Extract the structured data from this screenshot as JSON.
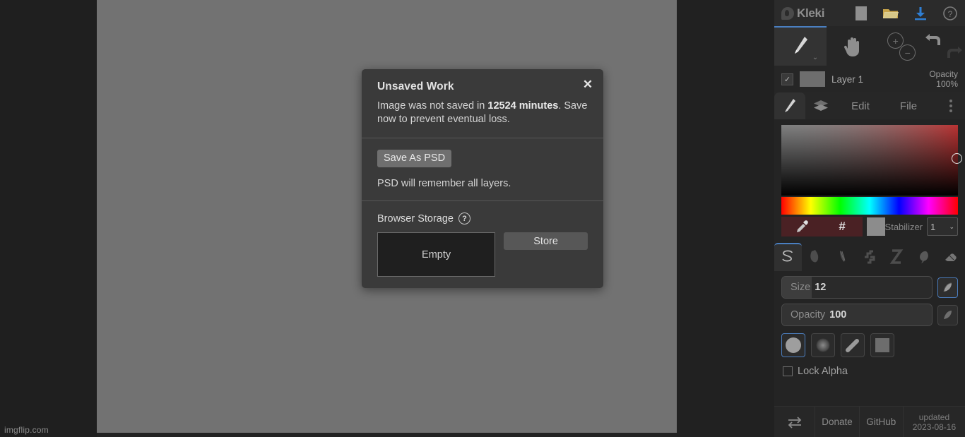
{
  "app": {
    "name": "Kleki",
    "watermark": "imgflip.com"
  },
  "topbar": {
    "icons": [
      {
        "name": "new-image-icon",
        "label": "New Image"
      },
      {
        "name": "open-folder-icon",
        "label": "Open"
      },
      {
        "name": "download-icon",
        "label": "Save / Download"
      },
      {
        "name": "help-icon",
        "label": "Help"
      }
    ]
  },
  "toolbar": {
    "brush_tool": "brush-tool",
    "hand_tool": "hand-tool",
    "zoom_in": "+",
    "zoom_out": "−",
    "undo": "undo-arrow",
    "redo": "redo-arrow"
  },
  "layer": {
    "visible": true,
    "name": "Layer 1",
    "opacity_label": "Opacity",
    "opacity_value": "100%"
  },
  "tabs": [
    {
      "name": "tab-brush",
      "label": "",
      "selected": true
    },
    {
      "name": "tab-layers",
      "label": "",
      "selected": false
    },
    {
      "name": "tab-edit",
      "label": "Edit",
      "selected": false
    },
    {
      "name": "tab-file",
      "label": "File",
      "selected": false
    },
    {
      "name": "tab-more",
      "label": "",
      "selected": false
    }
  ],
  "color_picker": {
    "hue_color": "#b33333",
    "current_swatch": "#8c8c8c",
    "eyedropper": "eyedropper-icon",
    "hex_button": "#",
    "stabilizer_label": "Stabilizer",
    "stabilizer_value": "1"
  },
  "brush_types": [
    {
      "name": "brush-pen",
      "selected": true
    },
    {
      "name": "brush-blend",
      "selected": false
    },
    {
      "name": "brush-sketchy",
      "selected": false
    },
    {
      "name": "brush-pixel",
      "selected": false
    },
    {
      "name": "brush-chemy",
      "selected": false
    },
    {
      "name": "brush-smudge",
      "selected": false
    },
    {
      "name": "brush-eraser",
      "selected": false
    }
  ],
  "brush_settings": {
    "size_label": "Size",
    "size_value": "12",
    "size_fill_pct": 20,
    "opacity_label": "Opacity",
    "opacity_value": "100",
    "opacity_fill_pct": 100,
    "shapes": [
      {
        "name": "shape-round-solid",
        "selected": true
      },
      {
        "name": "shape-round-noise",
        "selected": false
      },
      {
        "name": "shape-stroke",
        "selected": false
      },
      {
        "name": "shape-square",
        "selected": false
      }
    ],
    "lock_alpha_label": "Lock Alpha",
    "lock_alpha_checked": false
  },
  "footer": {
    "swap_icon": "swap-arrows-icon",
    "donate": "Donate",
    "github": "GitHub",
    "updated_line1": "updated",
    "updated_line2": "2023-08-16"
  },
  "dialog": {
    "title": "Unsaved Work",
    "close": "✕",
    "body_prefix": "Image was not saved in ",
    "body_strong": "12524 minutes",
    "body_suffix": ". Save now to prevent eventual loss.",
    "save_psd_button": "Save As PSD",
    "psd_note": "PSD will remember all layers.",
    "storage_label": "Browser Storage",
    "storage_help": "?",
    "storage_state": "Empty",
    "store_button": "Store"
  }
}
